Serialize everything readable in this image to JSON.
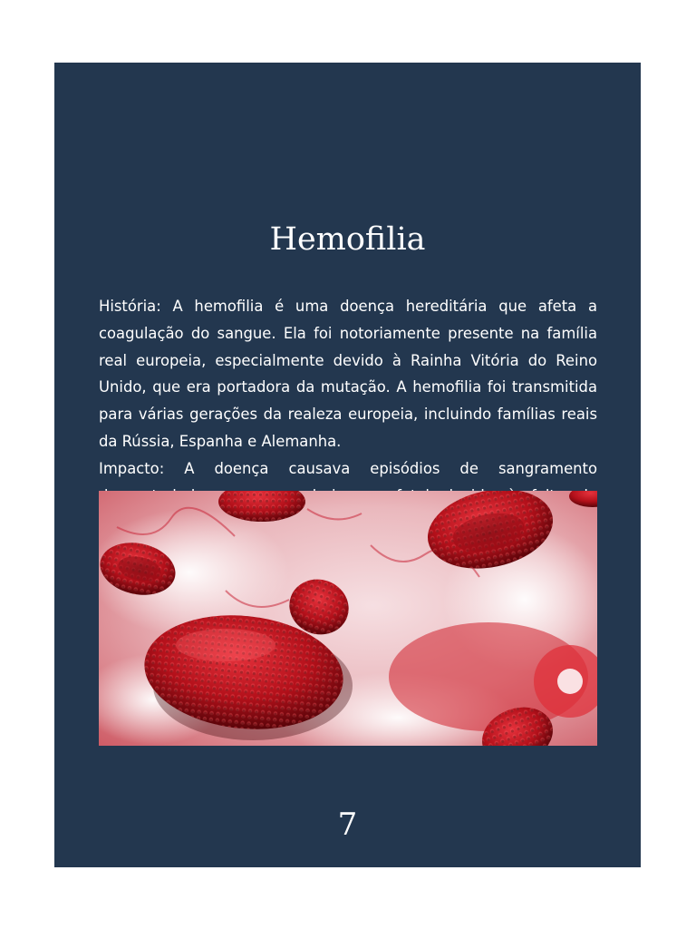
{
  "page": {
    "title": "Hemofilia",
    "paragraphs": [
      "História: A hemofilia é uma doença hereditária que afeta a coagulação do sangue. Ela foi notoriamente presente na família real europeia, especialmente devido à Rainha Vitória do Reino Unido, que era portadora da mutação. A hemofilia foi transmitida para várias gerações da realeza europeia, incluindo famílias reais da Rússia, Espanha e Alemanha.",
      "Impacto: A doença causava episódios de sangramento descontrolado, o que poderia ser fatal devido à falta de tratamento adequado na época."
    ],
    "page_number": "7"
  },
  "colors": {
    "background": "#23374f",
    "text": "#ffffff",
    "blood_red": "#c8101c"
  }
}
